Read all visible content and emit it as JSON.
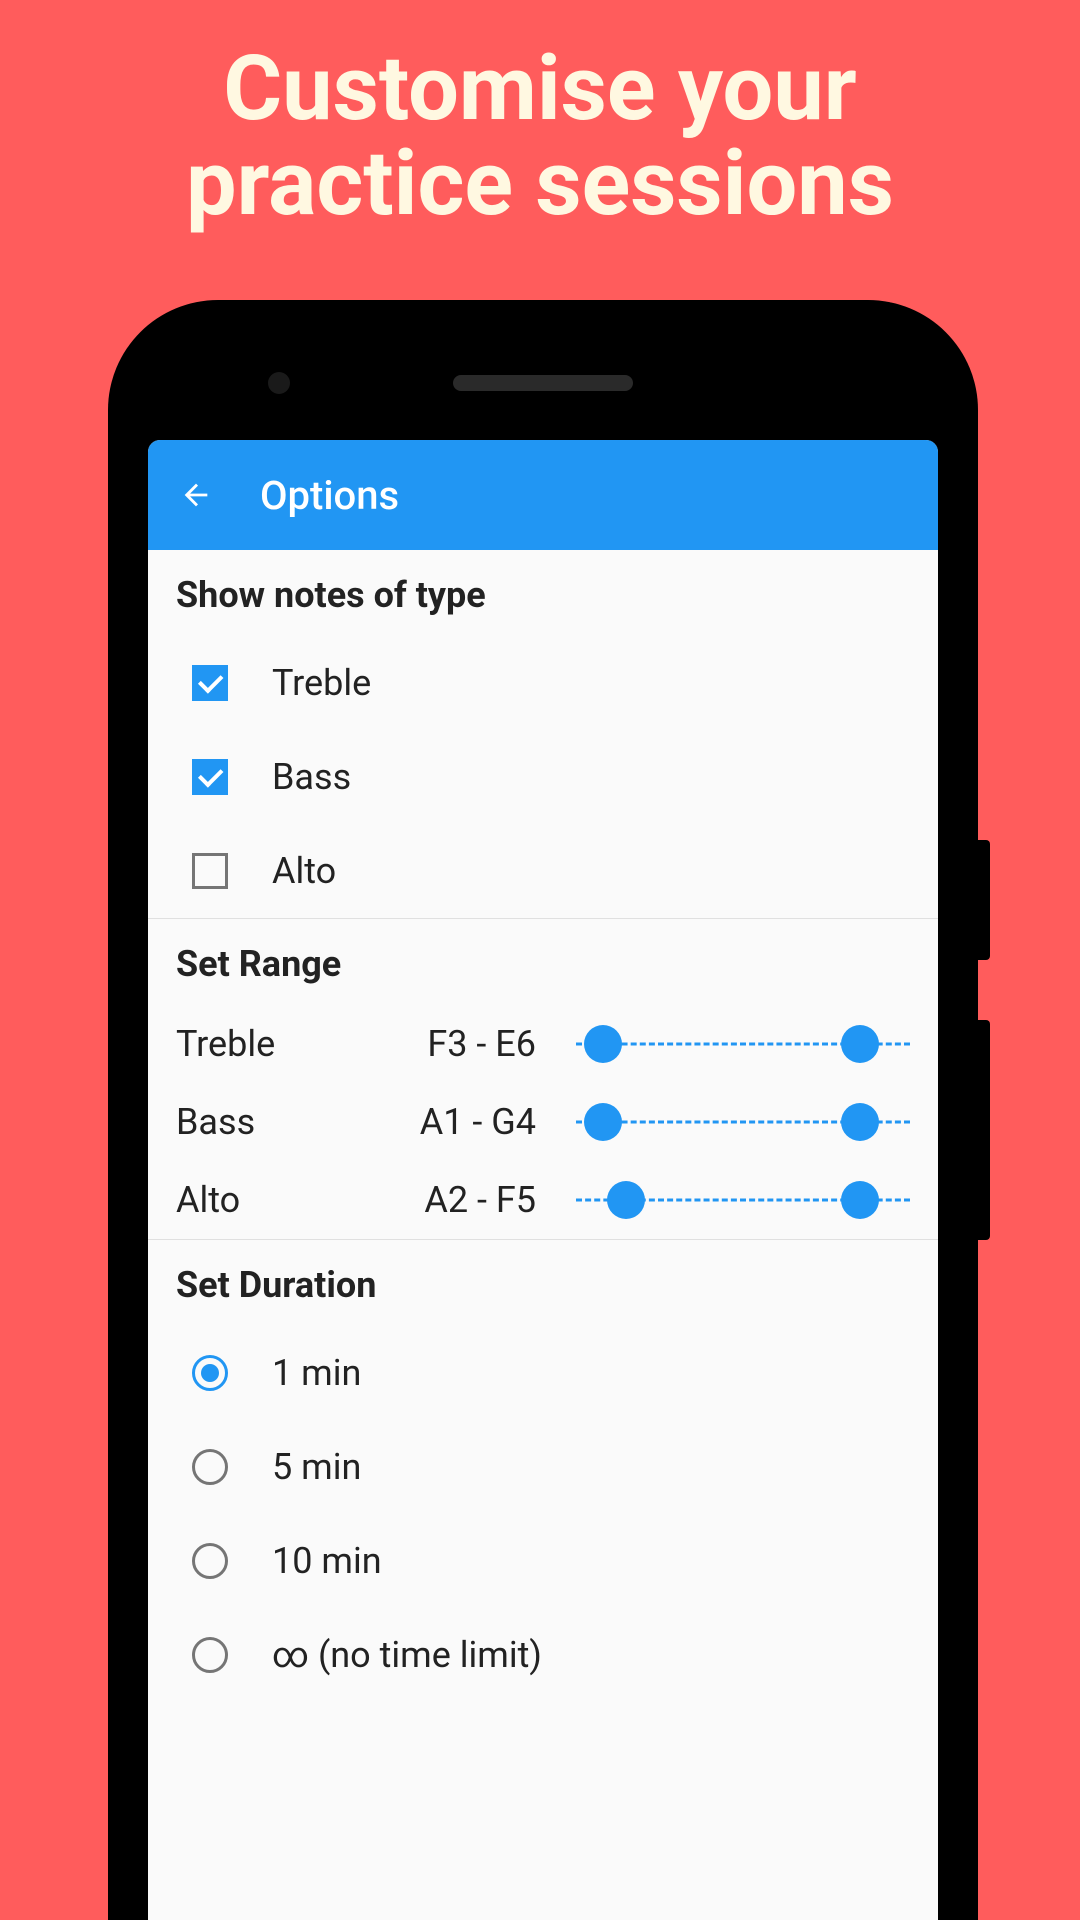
{
  "promo": {
    "title_line1": "Customise your",
    "title_line2": "practice sessions"
  },
  "appbar": {
    "title": "Options"
  },
  "sections": {
    "show_notes": {
      "header": "Show notes of type",
      "items": [
        {
          "label": "Treble",
          "checked": true
        },
        {
          "label": "Bass",
          "checked": true
        },
        {
          "label": "Alto",
          "checked": false
        }
      ]
    },
    "set_range": {
      "header": "Set Range",
      "rows": [
        {
          "name": "Treble",
          "value": "F3 - E6",
          "low": 8,
          "high": 85
        },
        {
          "name": "Bass",
          "value": "A1 - G4",
          "low": 8,
          "high": 85
        },
        {
          "name": "Alto",
          "value": "A2 - F5",
          "low": 15,
          "high": 85
        }
      ]
    },
    "set_duration": {
      "header": "Set Duration",
      "items": [
        {
          "label": "1 min",
          "selected": true
        },
        {
          "label": "5 min",
          "selected": false
        },
        {
          "label": "10 min",
          "selected": false
        },
        {
          "label": "∞ (no time limit)",
          "selected": false
        }
      ]
    }
  }
}
